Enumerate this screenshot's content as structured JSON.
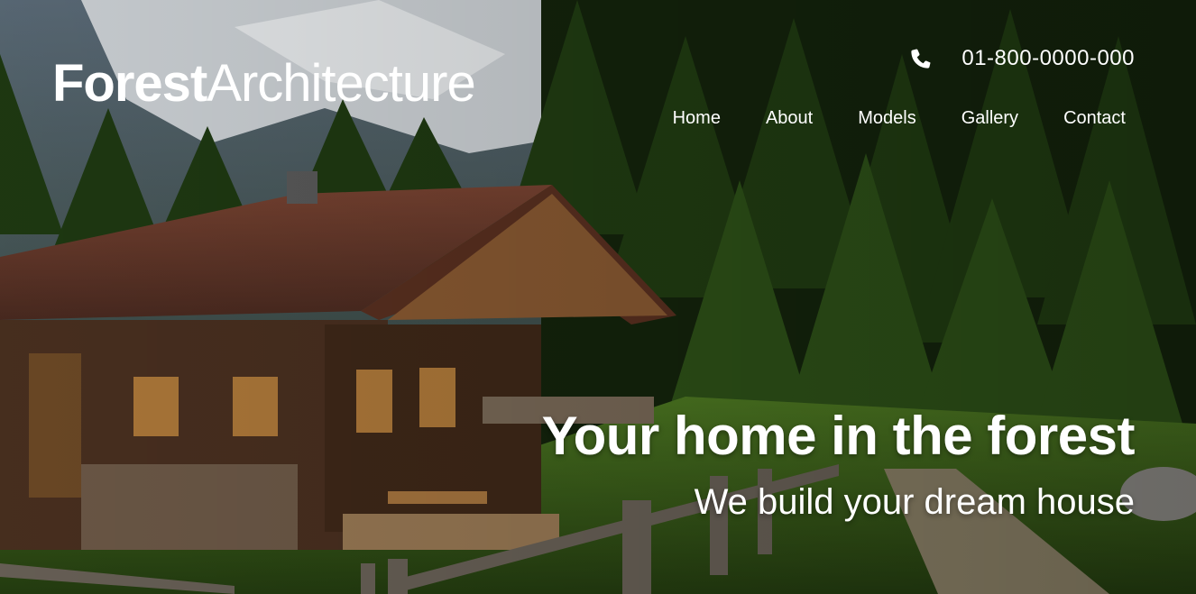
{
  "brand": {
    "bold": "Forest",
    "light": "Architecture"
  },
  "contact": {
    "phone": "01-800-0000-000",
    "icon": "phone-icon"
  },
  "nav": {
    "items": [
      "Home",
      "About",
      "Models",
      "Gallery",
      "Contact"
    ]
  },
  "hero": {
    "headline": "Your home in the forest",
    "subheadline": "We build your dream house",
    "image": "forest-cabin-photo"
  },
  "colors": {
    "text": "#ffffff",
    "forest": "#1f3a14",
    "roof": "#6b3a2a",
    "sky_snow": "#d9dde0"
  }
}
